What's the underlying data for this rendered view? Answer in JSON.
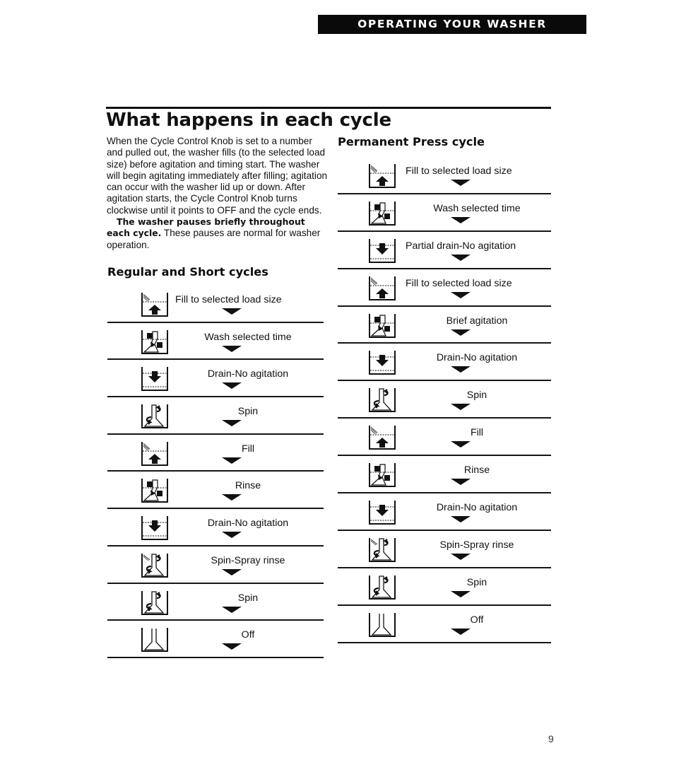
{
  "header": {
    "banner": "OPERATING YOUR WASHER"
  },
  "page": {
    "title": "What happens in each cycle",
    "intro": "When the Cycle Control Knob is set to a number and pulled out, the washer fills (to the selected load size) before agitation and timing start. The washer will begin agitating immediately after filling; agitation can occur with the washer lid up or down. After agitation starts, the Cycle Control Knob turns clockwise until it points to OFF and the cycle ends.",
    "note_bold": "The washer pauses briefly throughout each cycle.",
    "note_rest": " These pauses are normal for washer operation.",
    "page_number": "9"
  },
  "regular": {
    "heading": "Regular and Short cycles",
    "steps": [
      {
        "icon": "fill",
        "label": "Fill to selected load size"
      },
      {
        "icon": "wash",
        "label": "Wash selected time"
      },
      {
        "icon": "drain",
        "label": "Drain-No agitation"
      },
      {
        "icon": "spin",
        "label": "Spin"
      },
      {
        "icon": "fill",
        "label": "Fill"
      },
      {
        "icon": "wash",
        "label": "Rinse"
      },
      {
        "icon": "drain",
        "label": "Drain-No agitation"
      },
      {
        "icon": "spin-spray",
        "label": "Spin-Spray rinse"
      },
      {
        "icon": "spin",
        "label": "Spin"
      },
      {
        "icon": "off",
        "label": "Off"
      }
    ]
  },
  "permanent_press": {
    "heading": "Permanent Press cycle",
    "steps": [
      {
        "icon": "fill",
        "label": "Fill to selected load size"
      },
      {
        "icon": "wash",
        "label": "Wash selected time"
      },
      {
        "icon": "drain",
        "label": "Partial drain-No agitation"
      },
      {
        "icon": "fill",
        "label": "Fill to selected load size"
      },
      {
        "icon": "wash",
        "label": "Brief agitation"
      },
      {
        "icon": "drain",
        "label": "Drain-No agitation"
      },
      {
        "icon": "spin",
        "label": "Spin"
      },
      {
        "icon": "fill",
        "label": "Fill"
      },
      {
        "icon": "wash",
        "label": "Rinse"
      },
      {
        "icon": "drain",
        "label": "Drain-No agitation"
      },
      {
        "icon": "spin-spray",
        "label": "Spin-Spray rinse"
      },
      {
        "icon": "spin",
        "label": "Spin"
      },
      {
        "icon": "off",
        "label": "Off"
      }
    ]
  }
}
